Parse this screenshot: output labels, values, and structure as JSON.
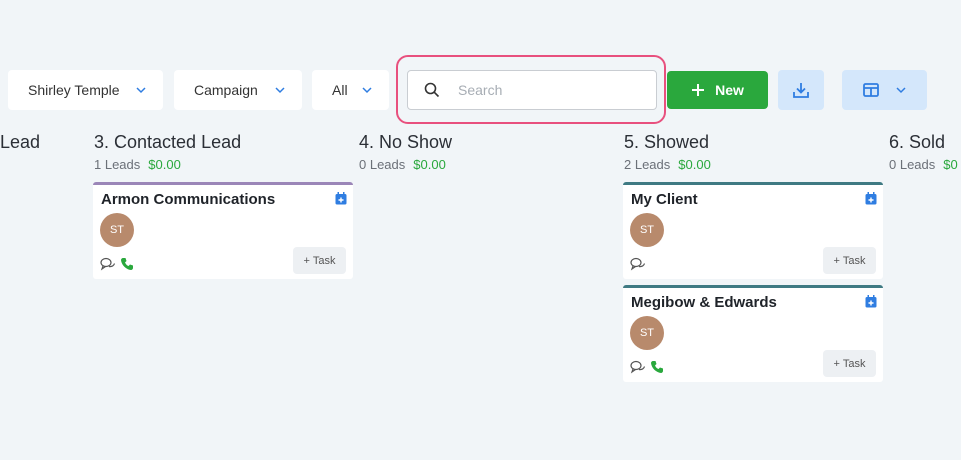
{
  "filters": {
    "user": "Shirley Temple",
    "campaign": "Campaign",
    "status": "All"
  },
  "search": {
    "placeholder": "Search",
    "value": ""
  },
  "toolbar": {
    "new_label": "New"
  },
  "columns": [
    {
      "title": "Lead",
      "count_label": "",
      "amount": ""
    },
    {
      "title": "3. Contacted Lead",
      "count_label": "1 Leads",
      "amount": "$0.00"
    },
    {
      "title": "4. No Show",
      "count_label": "0 Leads",
      "amount": "$0.00"
    },
    {
      "title": "5. Showed",
      "count_label": "2 Leads",
      "amount": "$0.00"
    },
    {
      "title": "6. Sold",
      "count_label": "0 Leads",
      "amount": "$0"
    }
  ],
  "cards": [
    {
      "name": "Armon Communications",
      "initials": "ST",
      "task_label": "+ Task",
      "bar_color": "#9b86b8"
    },
    {
      "name": "My Client",
      "initials": "ST",
      "task_label": "+ Task",
      "bar_color": "#3f7a83"
    },
    {
      "name": "Megibow & Edwards",
      "initials": "ST",
      "task_label": "+ Task",
      "bar_color": "#3f7a83"
    }
  ],
  "colors": {
    "accent_green": "#2aa83d",
    "highlight": "#e8507e",
    "light_blue": "#d4e7fb",
    "icon_blue": "#2f7de1"
  }
}
